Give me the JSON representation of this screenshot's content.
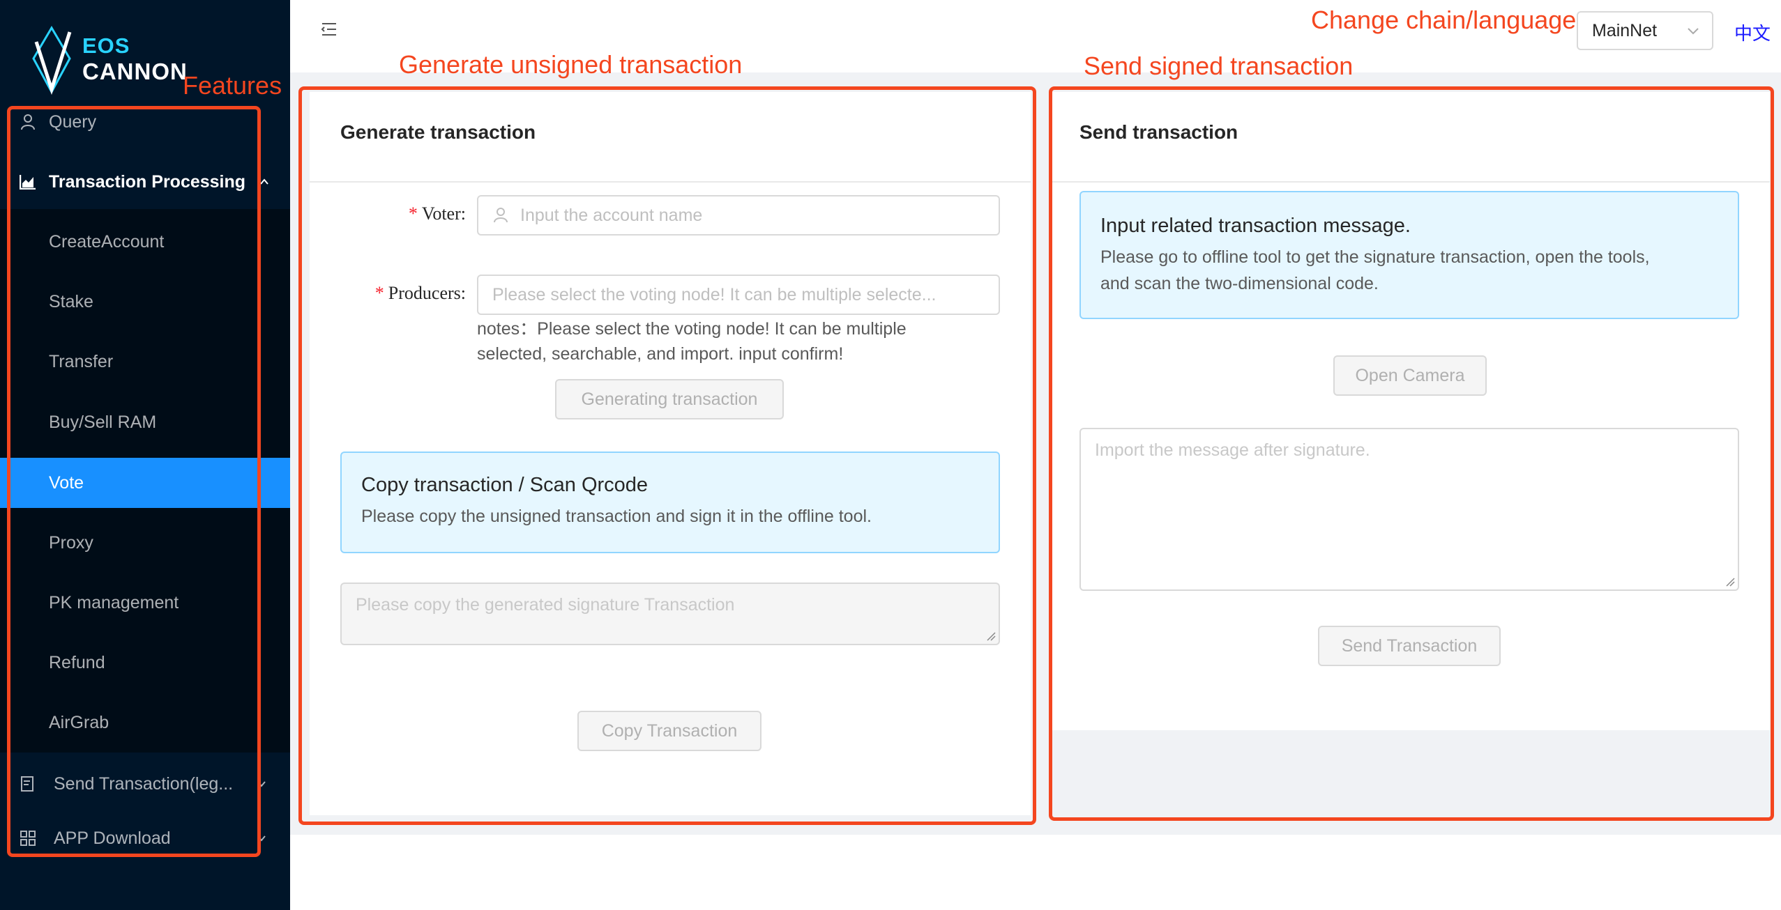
{
  "logo": {
    "line1": "EOS",
    "line2": "CANNON"
  },
  "sidebar": {
    "items": [
      {
        "label": "Query",
        "icon": "user-icon"
      },
      {
        "label": "Transaction Processing",
        "icon": "chart-icon"
      },
      {
        "label": "Send Transaction(leg...",
        "icon": "document-icon"
      },
      {
        "label": "APP Download",
        "icon": "grid-icon"
      }
    ],
    "submenu": [
      {
        "label": "CreateAccount"
      },
      {
        "label": "Stake"
      },
      {
        "label": "Transfer"
      },
      {
        "label": "Buy/Sell RAM"
      },
      {
        "label": "Vote",
        "active": true
      },
      {
        "label": "Proxy"
      },
      {
        "label": "PK management"
      },
      {
        "label": "Refund"
      },
      {
        "label": "AirGrab"
      }
    ]
  },
  "header": {
    "chain_select": "MainNet",
    "language": "中文"
  },
  "generate": {
    "title": "Generate transaction",
    "voter_label": "Voter",
    "voter_placeholder": "Input the account name",
    "producers_label": "Producers",
    "producers_placeholder": "Please select the voting node! It can be multiple selecte...",
    "notes_line1": "notes：Please select the voting node! It can be multiple",
    "notes_line2": "selected, searchable, and import. input confirm!",
    "generate_button": "Generating transaction",
    "alert_title": "Copy transaction / Scan Qrcode",
    "alert_desc": "Please copy the unsigned transaction and sign it in the offline tool.",
    "output_placeholder": "Please copy the generated signature Transaction",
    "copy_button": "Copy Transaction"
  },
  "send": {
    "title": "Send transaction",
    "alert_title": "Input related transaction message.",
    "alert_desc_line1": "Please go to offline tool to get the signature transaction, open the tools,",
    "alert_desc_line2": "and scan the two-dimensional code.",
    "camera_button": "Open Camera",
    "input_placeholder": "Import the message after signature.",
    "send_button": "Send Transaction"
  },
  "annotations": {
    "features": "Features",
    "generate": "Generate unsigned transaction",
    "send": "Send signed transaction",
    "change": "Change chain/language"
  },
  "colors": {
    "sidebar_bg": "#001529",
    "submenu_bg": "#000c17",
    "active": "#1890ff",
    "annotation": "#f4461f",
    "alert_bg": "#e6f7ff",
    "alert_border": "#91d5ff"
  }
}
